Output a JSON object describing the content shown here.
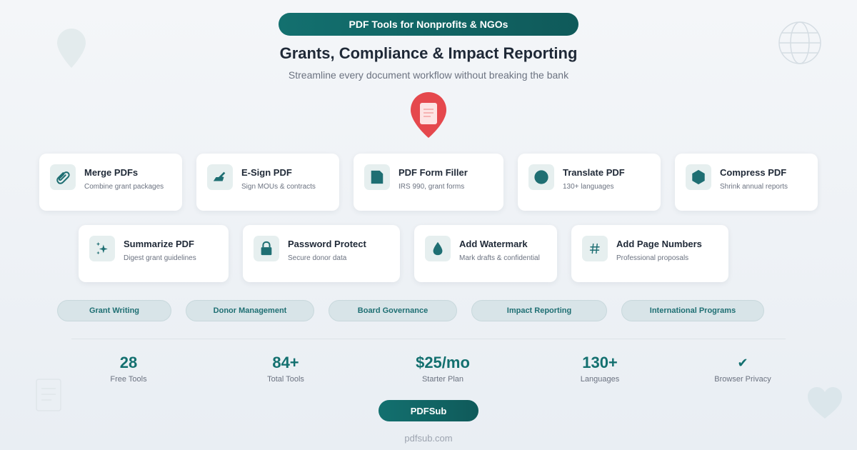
{
  "header": {
    "pill_label": "PDF Tools for Nonprofits & NGOs",
    "headline": "Grants, Compliance & Impact Reporting",
    "subheadline": "Streamline every document workflow without breaking the bank"
  },
  "tools": [
    {
      "title": "Merge PDFs",
      "desc": "Combine grant packages",
      "icon": "paperclip-icon"
    },
    {
      "title": "E-Sign PDF",
      "desc": "Sign MOUs & contracts",
      "icon": "signing-hand-icon"
    },
    {
      "title": "PDF Form Filler",
      "desc": "IRS 990, grant forms",
      "icon": "form-icon"
    },
    {
      "title": "Translate PDF",
      "desc": "130+ languages",
      "icon": "globe-icon"
    },
    {
      "title": "Compress PDF",
      "desc": "Shrink annual reports",
      "icon": "compress-icon"
    },
    {
      "title": "Summarize PDF",
      "desc": "Digest grant guidelines",
      "icon": "sparkles-icon"
    },
    {
      "title": "Password Protect",
      "desc": "Secure donor data",
      "icon": "lock-icon"
    },
    {
      "title": "Add Watermark",
      "desc": "Mark drafts & confidential",
      "icon": "droplet-icon"
    },
    {
      "title": "Add Page Numbers",
      "desc": "Professional proposals",
      "icon": "hash-icon"
    }
  ],
  "chips": [
    "Grant Writing",
    "Donor Management",
    "Board Governance",
    "Impact Reporting",
    "International Programs"
  ],
  "stats": [
    {
      "value": "28",
      "label": "Free Tools"
    },
    {
      "value": "84+",
      "label": "Total Tools"
    },
    {
      "value": "$25/mo",
      "label": "Starter Plan"
    },
    {
      "value": "130+",
      "label": "Languages"
    },
    {
      "value": "✔",
      "label": "Browser Privacy"
    }
  ],
  "brand": {
    "button_label": "PDFSub",
    "url": "pdfsub.com"
  },
  "colors": {
    "accent": "#13706f",
    "pin_red": "#e5484d",
    "chip_bg": "#d8e4e8"
  }
}
